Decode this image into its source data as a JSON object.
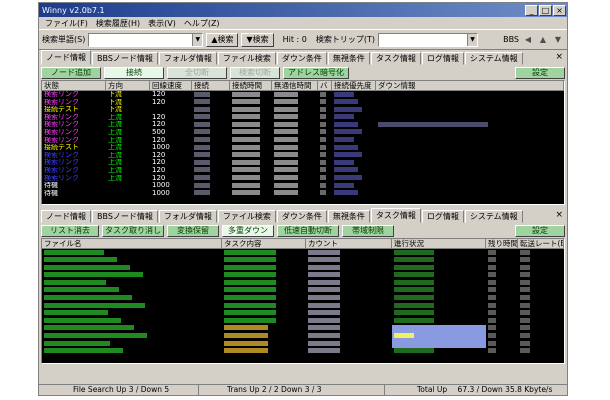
{
  "window": {
    "title": "Winny v2.0b7.1"
  },
  "menu": [
    "ファイル(F)",
    "検索履歴(H)",
    "表示(V)",
    "ヘルプ(Z)"
  ],
  "searchbar": {
    "keyword_label": "検索単語(S)",
    "search_btn": "▲検索",
    "search_btn2": "▼検索",
    "hit_label": "Hit : 0",
    "trip_label": "検索トリップ(T)",
    "bbs_label": "BBS"
  },
  "top_tabs": [
    "ノード情報",
    "BBSノード情報",
    "フォルダ情報",
    "ファイル検索",
    "ダウン条件",
    "無視条件",
    "タスク情報",
    "ログ情報",
    "システム情報"
  ],
  "node_toolbar": {
    "add_node": "ノード追加",
    "connect": "接続",
    "disconnect_all": "全切断",
    "search_disconnect": "検索切断",
    "address_encrypt": "アドレス暗号化",
    "settings": "設定"
  },
  "node_columns": [
    "状態",
    "方向",
    "回線速度",
    "接続",
    "接続時間",
    "無通信時間",
    "バ",
    "接続優先度",
    "ダウン情報"
  ],
  "node_rows": [
    {
      "state": "検索リンク",
      "dir": "下流",
      "speed": "120",
      "color": "#ff40ff",
      "dircolor": "#ffff00"
    },
    {
      "state": "検索リンク",
      "dir": "下流",
      "speed": "120",
      "color": "#ff40ff",
      "dircolor": "#ffff00"
    },
    {
      "state": "接続テスト",
      "dir": "下流",
      "speed": "",
      "color": "#ffff00",
      "dircolor": "#ffff00"
    },
    {
      "state": "検索リンク",
      "dir": "上流",
      "speed": "120",
      "color": "#ff40ff",
      "dircolor": "#00ff00"
    },
    {
      "state": "検索リンク",
      "dir": "上流",
      "speed": "120",
      "color": "#ff40ff",
      "dircolor": "#00ff00"
    },
    {
      "state": "検索リンク",
      "dir": "上流",
      "speed": "500",
      "color": "#ff40ff",
      "dircolor": "#00ff00"
    },
    {
      "state": "検索リンク",
      "dir": "上流",
      "speed": "120",
      "color": "#ff40ff",
      "dircolor": "#00ff00"
    },
    {
      "state": "接続テスト",
      "dir": "上流",
      "speed": "1000",
      "color": "#ffff00",
      "dircolor": "#00ff00"
    },
    {
      "state": "検索リンク",
      "dir": "上流",
      "speed": "120",
      "color": "#4040ff",
      "dircolor": "#00ff00"
    },
    {
      "state": "検索リンク",
      "dir": "上流",
      "speed": "120",
      "color": "#4040ff",
      "dircolor": "#00ff00"
    },
    {
      "state": "検索リンク",
      "dir": "上流",
      "speed": "120",
      "color": "#4040ff",
      "dircolor": "#00ff00"
    },
    {
      "state": "検索リンク",
      "dir": "上流",
      "speed": "120",
      "color": "#4040ff",
      "dircolor": "#00ff00"
    },
    {
      "state": "待機",
      "dir": "",
      "speed": "1000",
      "color": "#ffffff",
      "dircolor": "#ffffff"
    },
    {
      "state": "待機",
      "dir": "",
      "speed": "1000",
      "color": "#ffffff",
      "dircolor": "#ffffff"
    }
  ],
  "bottom_tabs": [
    "ノード情報",
    "BBSノード情報",
    "フォルダ情報",
    "ファイル検索",
    "ダウン条件",
    "無視条件",
    "タスク情報",
    "ログ情報",
    "システム情報"
  ],
  "task_toolbar": {
    "clear_list": "リスト消去",
    "cancel_task": "タスク取り消し",
    "convert_save": "変換保留",
    "multi_down": "多重ダウン",
    "low_speed_cut": "低速自動切断",
    "band_limit": "帯域制限",
    "settings": "設定"
  },
  "task_columns": [
    "ファイル名",
    "タスク内容",
    "カウント",
    "進行状況",
    "残り時間",
    "転送レート(B)"
  ],
  "status": {
    "file_search": "File Search Up 3 / Down 5",
    "trans": "Trans Up 2 / 2  Down 3 / 3",
    "total_up": "Total Up",
    "rate": "67.3 / Down   35.8 Kbyte/s"
  },
  "colors": {
    "accent": "#1c3c8c",
    "button_green": "#9fd39f",
    "panel_bg": "#000000"
  }
}
